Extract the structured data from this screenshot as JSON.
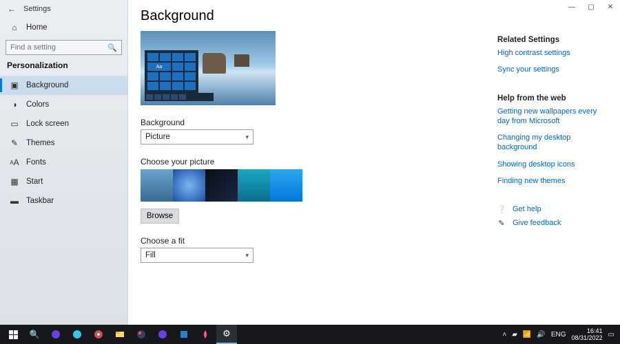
{
  "app": {
    "title": "Settings"
  },
  "sidebar": {
    "home": "Home",
    "search_placeholder": "Find a setting",
    "section_title": "Personalization",
    "items": [
      {
        "icon": "image-icon",
        "label": "Background",
        "selected": true
      },
      {
        "icon": "palette-icon",
        "label": "Colors"
      },
      {
        "icon": "lock-icon",
        "label": "Lock screen"
      },
      {
        "icon": "themes-icon",
        "label": "Themes"
      },
      {
        "icon": "fonts-icon",
        "label": "Fonts"
      },
      {
        "icon": "start-icon",
        "label": "Start"
      },
      {
        "icon": "taskbar-icon",
        "label": "Taskbar"
      }
    ]
  },
  "main": {
    "page_title": "Background",
    "background_label": "Background",
    "background_value": "Picture",
    "choose_picture_label": "Choose your picture",
    "browse_label": "Browse",
    "choose_fit_label": "Choose a fit",
    "fit_value": "Fill"
  },
  "right": {
    "related_title": "Related Settings",
    "links_related": [
      "High contrast settings",
      "Sync your settings"
    ],
    "help_title": "Help from the web",
    "links_help": [
      "Getting new wallpapers every day from Microsoft",
      "Changing my desktop background",
      "Showing desktop icons",
      "Finding new themes"
    ],
    "get_help": "Get help",
    "give_feedback": "Give feedback"
  },
  "taskbar": {
    "tray_text": "ENG",
    "clock_time": "16:41",
    "clock_date": "08/31/2022"
  }
}
